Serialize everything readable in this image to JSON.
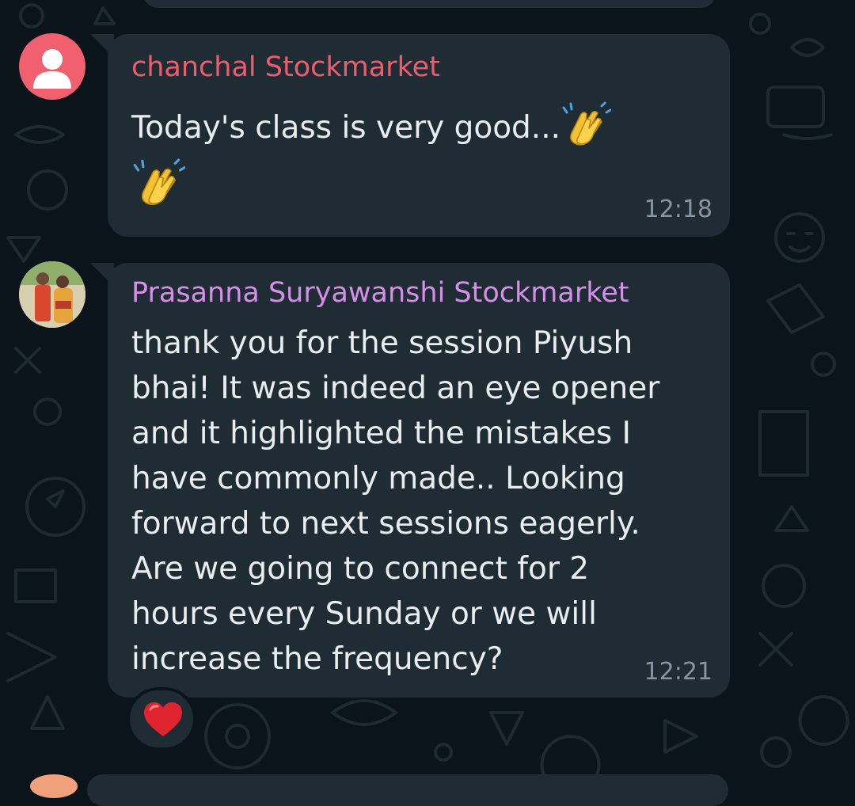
{
  "colors": {
    "chat_background": "#0b141a",
    "bubble_background": "#1f2c34",
    "message_text": "#e9edef",
    "timestamp_text": "#8696a0",
    "sender_1_name": "#f15c6d",
    "sender_2_name": "#d68fe8",
    "reaction_heart": "#e0242f"
  },
  "messages": [
    {
      "sender": "chanchal Stockmarket",
      "text": "Today's class is very good...",
      "emojis": [
        "clapping-hands",
        "clapping-hands"
      ],
      "time": "12:18",
      "avatar": "default-person-avatar"
    },
    {
      "sender": "Prasanna Suryawanshi Stockmarket",
      "text": "thank you for the session Piyush\nbhai! It was indeed an eye opener\nand it highlighted the mistakes I\nhave commonly made.. Looking\nforward to next sessions eagerly.\nAre we going to connect for 2\nhours every Sunday or we will\nincrease the frequency?",
      "time": "12:21",
      "avatar": "profile-photo",
      "reaction": "❤️"
    }
  ]
}
